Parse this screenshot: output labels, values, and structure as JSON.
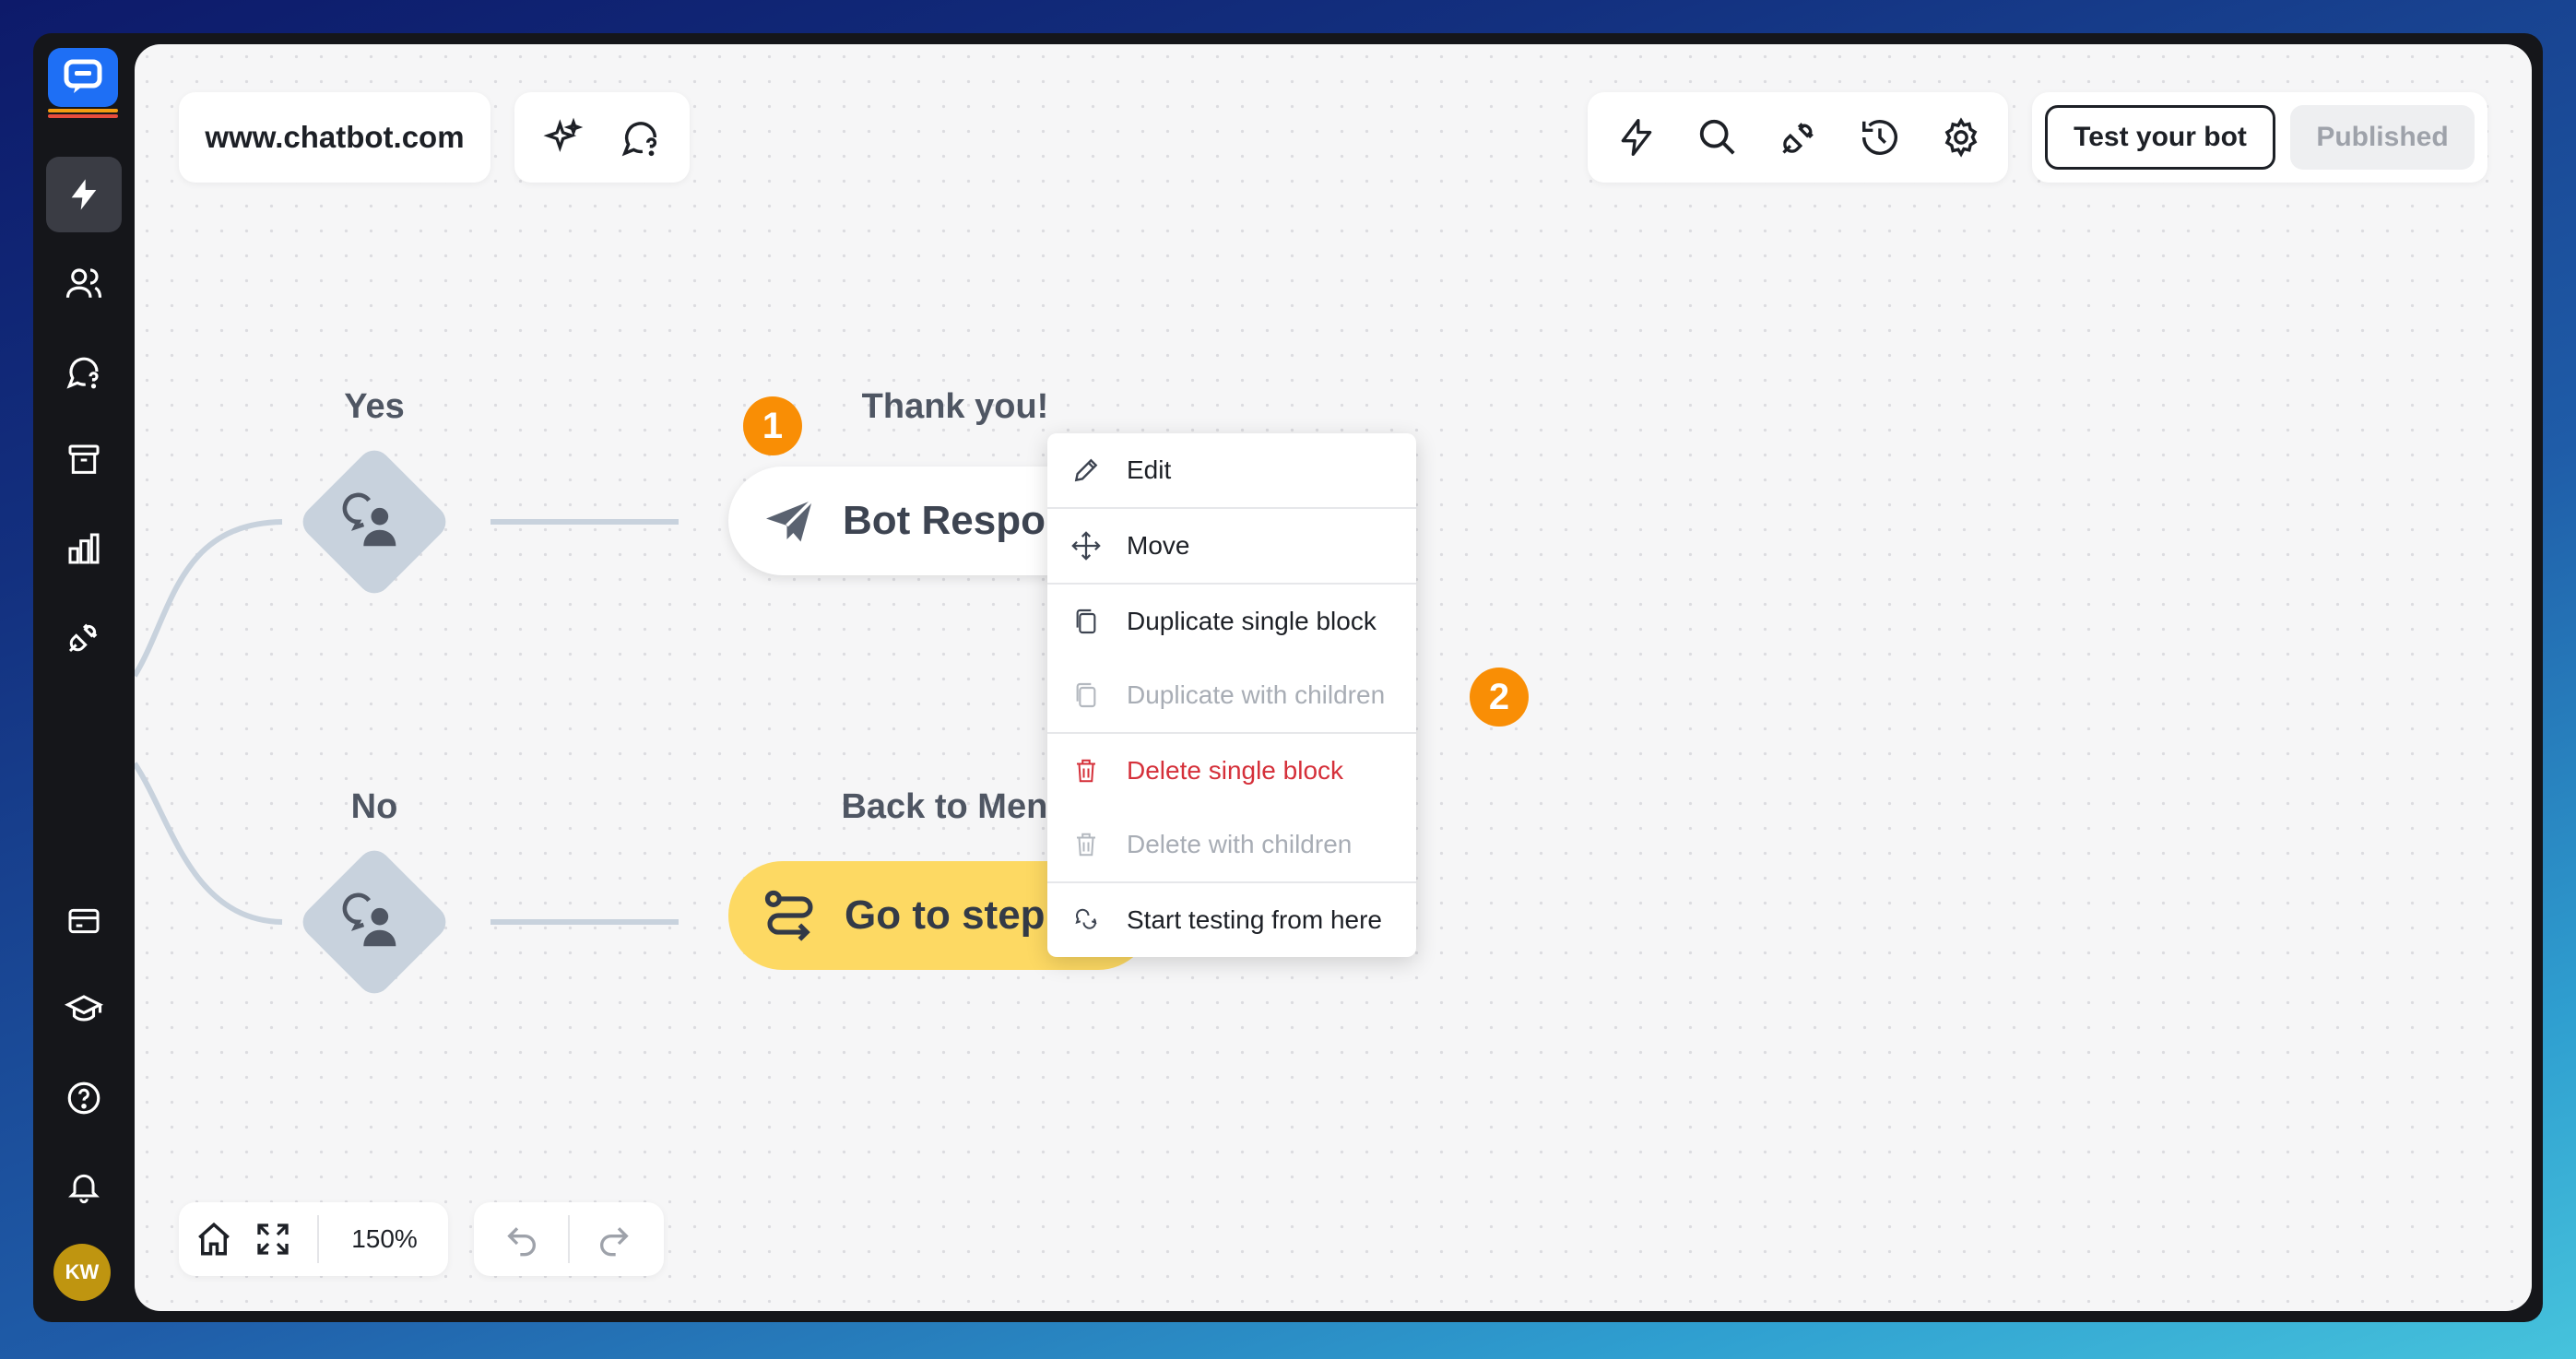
{
  "sidebar": {
    "items": [
      {
        "icon": "lightning-icon",
        "active": true
      },
      {
        "icon": "users-icon"
      },
      {
        "icon": "chat-question-icon"
      },
      {
        "icon": "archive-icon"
      },
      {
        "icon": "bar-chart-icon"
      },
      {
        "icon": "plug-icon"
      },
      {
        "icon": "billing-card-icon"
      },
      {
        "icon": "graduation-cap-icon"
      },
      {
        "icon": "help-circle-icon"
      },
      {
        "icon": "bell-icon"
      }
    ],
    "avatar_initials": "KW"
  },
  "header": {
    "site": "www.chatbot.com",
    "test_button": "Test your bot",
    "published_button": "Published"
  },
  "flow": {
    "branch_yes": "Yes",
    "branch_no": "No",
    "step1_title": "Thank you!",
    "step1_label": "Bot Respons",
    "step1_label_trail": "e",
    "step2_title": "Back to Menu",
    "step2_label": "Go to step",
    "badge_1": "1",
    "badge_2": "2"
  },
  "context_menu": {
    "items": [
      {
        "label": "Edit",
        "icon": "pencil-icon"
      },
      {
        "label": "Move",
        "icon": "move-icon"
      },
      {
        "label": "Duplicate single block",
        "icon": "copy-icon"
      },
      {
        "label": "Duplicate with children",
        "icon": "copy-icon",
        "disabled": true
      },
      {
        "label": "Delete single block",
        "icon": "trash-icon",
        "danger": true
      },
      {
        "label": "Delete with children",
        "icon": "trash-icon",
        "disabled": true
      },
      {
        "label": "Start testing from here",
        "icon": "chat-test-icon"
      }
    ]
  },
  "zoom": {
    "value": "150%"
  },
  "colors": {
    "accent": "#1e6ff5",
    "badge": "#f98e05",
    "danger": "#d5303a",
    "go_to_step": "#fdd963"
  }
}
